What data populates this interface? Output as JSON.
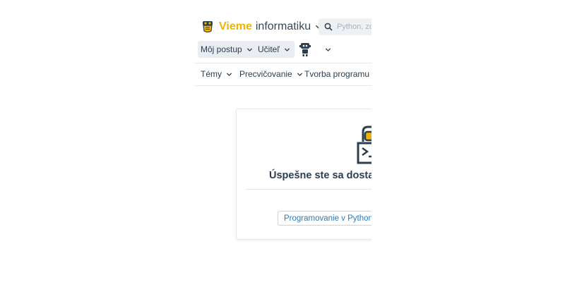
{
  "header": {
    "brand_word1": "Vieme",
    "brand_word2": "informatiku",
    "search_placeholder": "Python, zoznam, ..."
  },
  "toolbar": {
    "progress_label": "Môj postup",
    "teacher_label": "Učiteľ"
  },
  "menu": {
    "items": [
      {
        "label": "Témy"
      },
      {
        "label": "Precvičovanie"
      },
      {
        "label": "Tvorba programu"
      }
    ]
  },
  "card": {
    "heading": "Úspešne ste sa dostali n",
    "tag_label": "Programovanie v Pythone",
    "tag_close": "x"
  },
  "colors": {
    "brand_accent": "#f0b400",
    "text_dark": "#2c3e50",
    "link_blue": "#2e7bb8",
    "pill_bg": "#e9edf1"
  },
  "icons": {
    "logo": "owl-logo-icon",
    "search": "search-icon",
    "robot": "robot-avatar-icon",
    "chevron": "chevron-down-icon",
    "illustration": "python-terminal-icon"
  }
}
